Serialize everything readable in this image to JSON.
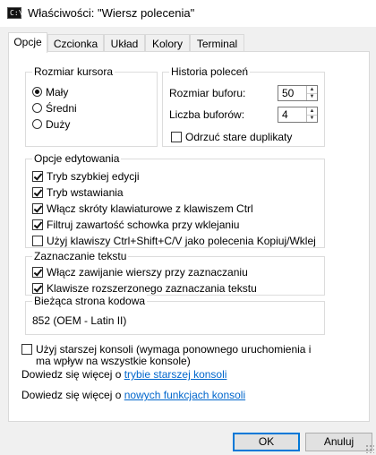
{
  "window": {
    "title": "Właściwości: \"Wiersz polecenia\"",
    "icon": "console-icon",
    "icon_text": "C:\\."
  },
  "tabs": [
    {
      "label": "Opcje",
      "active": true
    },
    {
      "label": "Czcionka",
      "active": false
    },
    {
      "label": "Układ",
      "active": false
    },
    {
      "label": "Kolory",
      "active": false
    },
    {
      "label": "Terminal",
      "active": false
    }
  ],
  "cursor_size": {
    "title": "Rozmiar kursora",
    "options": [
      {
        "label": "Mały",
        "checked": true
      },
      {
        "label": "Średni",
        "checked": false
      },
      {
        "label": "Duży",
        "checked": false
      }
    ]
  },
  "history": {
    "title": "Historia poleceń",
    "buffer_size_label": "Rozmiar buforu:",
    "buffer_size_value": "50",
    "buffer_count_label": "Liczba buforów:",
    "buffer_count_value": "4",
    "discard_label": "Odrzuć stare duplikaty",
    "discard_checked": false
  },
  "edit_options": {
    "title": "Opcje edytowania",
    "items": [
      {
        "label": "Tryb szybkiej edycji",
        "checked": true
      },
      {
        "label": "Tryb wstawiania",
        "checked": true
      },
      {
        "label": "Włącz skróty klawiaturowe z klawiszem Ctrl",
        "checked": true
      },
      {
        "label": "Filtruj zawartość schowka przy wklejaniu",
        "checked": true
      },
      {
        "label": "Użyj klawiszy Ctrl+Shift+C/V jako polecenia Kopiuj/Wklej",
        "checked": false
      }
    ]
  },
  "selection": {
    "title": "Zaznaczanie tekstu",
    "items": [
      {
        "label": "Włącz zawijanie wierszy przy zaznaczaniu",
        "checked": true
      },
      {
        "label": "Klawisze rozszerzonego zaznaczania tekstu",
        "checked": true
      }
    ]
  },
  "codepage": {
    "title": "Bieżąca strona kodowa",
    "value": "852   (OEM - Latin II)"
  },
  "legacy": {
    "checked": false,
    "line1": "Użyj starszej konsoli (wymaga ponownego uruchomienia i",
    "line2": "ma wpływ na wszystkie konsole)"
  },
  "links": {
    "legacy_prefix": "Dowiedz się więcej o ",
    "legacy_link": "trybie starszej konsoli",
    "new_prefix": "Dowiedz się więcej o ",
    "new_link": "nowych funkcjach konsoli"
  },
  "buttons": {
    "ok": "OK",
    "cancel": "Anuluj"
  }
}
